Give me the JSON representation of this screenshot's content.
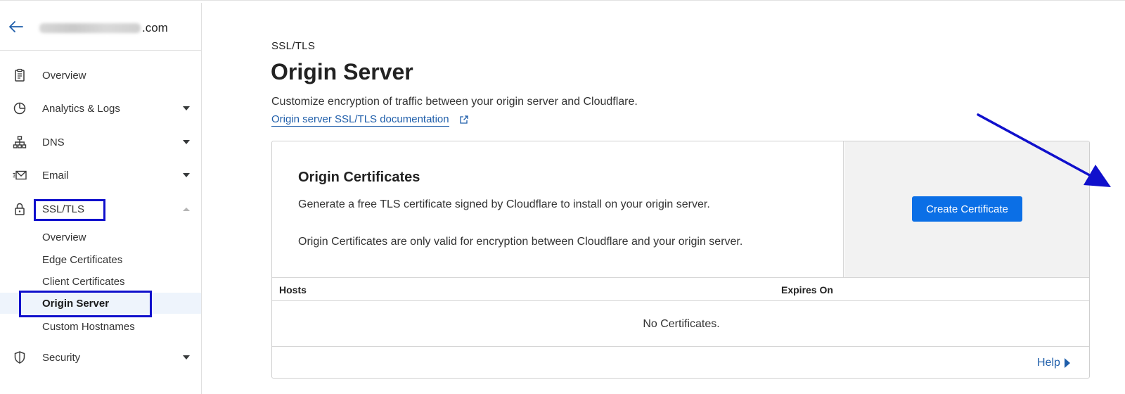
{
  "site": {
    "name_suffix": ".com",
    "back_icon": "arrow-left-icon"
  },
  "sidebar": {
    "items": [
      {
        "label": "Overview",
        "icon": "clipboard-icon",
        "has_caret": false
      },
      {
        "label": "Analytics & Logs",
        "icon": "pie-chart-icon",
        "has_caret": true
      },
      {
        "label": "DNS",
        "icon": "network-icon",
        "has_caret": true
      },
      {
        "label": "Email",
        "icon": "envelope-icon",
        "has_caret": true
      },
      {
        "label": "SSL/TLS",
        "icon": "lock-icon",
        "has_caret": true,
        "expanded": true
      },
      {
        "label": "Security",
        "icon": "shield-icon",
        "has_caret": true
      }
    ],
    "ssl_sub_items": [
      {
        "label": "Overview",
        "active": false
      },
      {
        "label": "Edge Certificates",
        "active": false
      },
      {
        "label": "Client Certificates",
        "active": false
      },
      {
        "label": "Origin Server",
        "active": true
      },
      {
        "label": "Custom Hostnames",
        "active": false
      }
    ]
  },
  "main": {
    "breadcrumb": "SSL/TLS",
    "title": "Origin Server",
    "description": "Customize encryption of traffic between your origin server and Cloudflare.",
    "doc_link": "Origin server SSL/TLS documentation",
    "card": {
      "title": "Origin Certificates",
      "text1": "Generate a free TLS certificate signed by Cloudflare to install on your origin server.",
      "text2": "Origin Certificates are only valid for encryption between Cloudflare and your origin server.",
      "button": "Create Certificate"
    },
    "table": {
      "columns": [
        "Hosts",
        "Expires On"
      ],
      "empty_text": "No Certificates."
    },
    "help": "Help"
  },
  "colors": {
    "accent": "#0b6fe6",
    "link": "#1f5eaa",
    "annotation": "#1010cc",
    "active_bg": "#eef4fc"
  }
}
